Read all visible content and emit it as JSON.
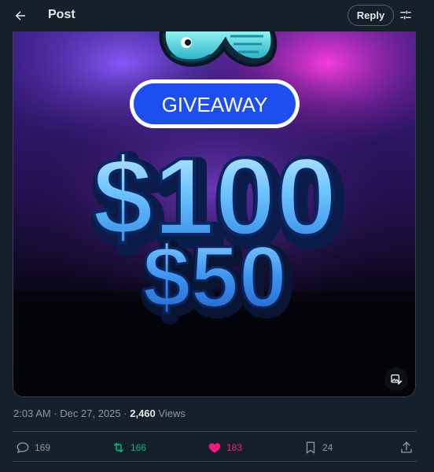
{
  "header": {
    "title": "Post",
    "reply_label": "Reply"
  },
  "media": {
    "banner_text": "GIVEAWAY",
    "amount_primary": "$100",
    "amount_secondary": "$50",
    "mascot": "snake-mascot"
  },
  "post": {
    "time": "2:03 AM",
    "separator": "·",
    "date": "Dec 27, 2025",
    "views_count": "2,460",
    "views_label": "Views"
  },
  "actions": {
    "replies": "169",
    "reposts": "166",
    "likes": "183",
    "bookmarks": "24"
  },
  "colors": {
    "background": "#15202b",
    "muted_text": "#8b98a5",
    "repost_green": "#00ba7c",
    "like_pink": "#f91880",
    "banner_blue": "#1d4ff0"
  },
  "icons": {
    "back": "arrow-left-icon",
    "filter": "sliders-icon",
    "alt": "image-edit-icon",
    "reply": "comment-icon",
    "repost": "repost-icon",
    "like": "heart-icon",
    "bookmark": "bookmark-icon",
    "share": "share-icon"
  }
}
